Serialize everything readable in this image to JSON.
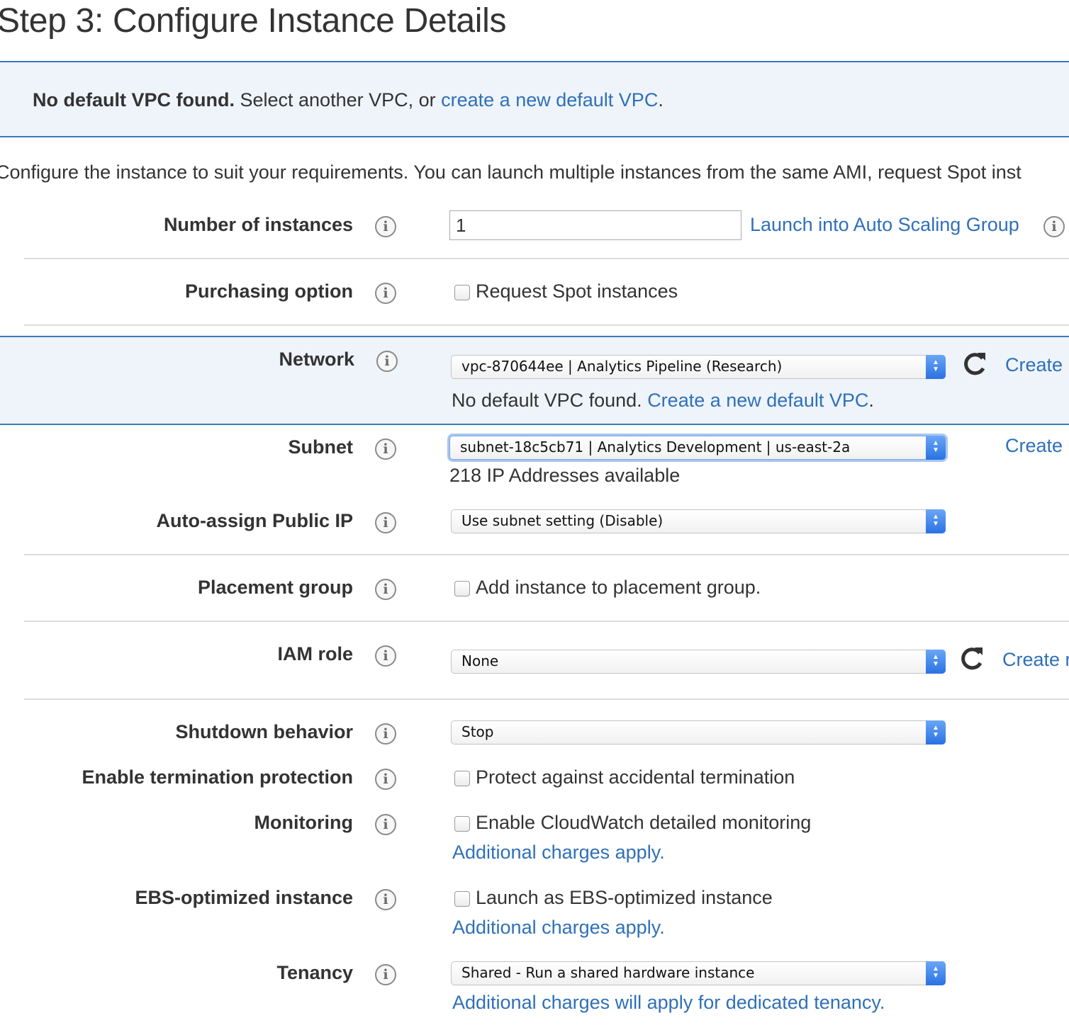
{
  "title": "Step 3: Configure Instance Details",
  "alert": {
    "bold": "No default VPC found.",
    "text": " Select another VPC, or ",
    "link": "create a new default VPC",
    "end": "."
  },
  "description": "Configure the instance to suit your requirements. You can launch multiple instances from the same AMI, request Spot inst",
  "rows": {
    "number_of_instances": {
      "label": "Number of instances",
      "value": "1",
      "link": "Launch into Auto Scaling Group"
    },
    "purchasing_option": {
      "label": "Purchasing option",
      "checkbox_label": "Request Spot instances",
      "checked": false
    },
    "network": {
      "label": "Network",
      "selected": "vpc-870644ee | Analytics Pipeline (Research)",
      "create": "Create",
      "note_text": "No default VPC found.",
      "note_link": "Create a new default VPC",
      "note_end": "."
    },
    "subnet": {
      "label": "Subnet",
      "selected": "subnet-18c5cb71 | Analytics Development | us-east-2a",
      "create": "Create",
      "available": "218 IP Addresses available"
    },
    "auto_assign_public_ip": {
      "label": "Auto-assign Public IP",
      "selected": "Use subnet setting (Disable)"
    },
    "placement_group": {
      "label": "Placement group",
      "checkbox_label": "Add instance to placement group.",
      "checked": false
    },
    "iam_role": {
      "label": "IAM role",
      "selected": "None",
      "create": "Create r"
    },
    "shutdown_behavior": {
      "label": "Shutdown behavior",
      "selected": "Stop"
    },
    "termination_protection": {
      "label": "Enable termination protection",
      "checkbox_label": "Protect against accidental termination",
      "checked": false
    },
    "monitoring": {
      "label": "Monitoring",
      "checkbox_label": "Enable CloudWatch detailed monitoring",
      "checked": false,
      "charges": "Additional charges apply."
    },
    "ebs_optimized": {
      "label": "EBS-optimized instance",
      "checkbox_label": "Launch as EBS-optimized instance",
      "checked": false,
      "charges": "Additional charges apply."
    },
    "tenancy": {
      "label": "Tenancy",
      "selected": "Shared - Run a shared hardware instance",
      "charges": "Additional charges will apply for dedicated tenancy."
    }
  },
  "colors": {
    "link": "#2f70b8",
    "alert_border": "#3c78c0",
    "alert_bg": "#eef4fa",
    "select_arrow": "#2a72e4"
  },
  "icons": {
    "info": "info-icon",
    "refresh": "refresh-icon",
    "select_arrows": "chevron-updown-icon"
  }
}
